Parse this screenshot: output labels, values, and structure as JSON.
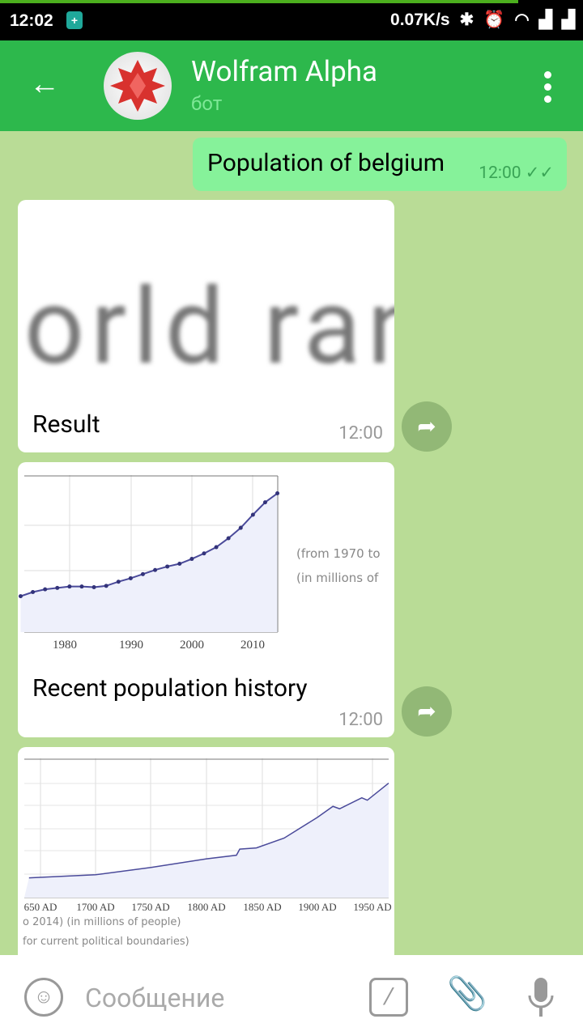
{
  "status_bar": {
    "time": "12:02",
    "net_speed": "0.07K/s",
    "icons": [
      "notification-icon",
      "bluetooth-icon",
      "alarm-icon",
      "wifi-icon",
      "signal-icon",
      "signal-icon"
    ]
  },
  "header": {
    "title": "Wolfram Alpha",
    "subtitle": "бот",
    "accent": "#2db84c"
  },
  "messages": [
    {
      "type": "outgoing",
      "text": "Population of belgium",
      "time": "12:00",
      "status": "read"
    },
    {
      "type": "incoming",
      "image_text": "orld ran",
      "caption": "Result",
      "time": "12:00"
    },
    {
      "type": "incoming",
      "caption": "Recent population history",
      "time": "12:00",
      "image": {
        "note1": "(from 1970 to",
        "note2": "(in millions of",
        "x_ticks": [
          "1980",
          "1990",
          "2000",
          "2010"
        ]
      }
    },
    {
      "type": "incoming",
      "image": {
        "note1": "o 2014)  (in millions of people)",
        "note2": "for current political boundaries)",
        "x_ticks": [
          "650 AD",
          "1700 AD",
          "1750 AD",
          "1800 AD",
          "1850 AD",
          "1900 AD",
          "1950 AD"
        ]
      }
    }
  ],
  "chart_data": [
    {
      "type": "line",
      "xlabel": "",
      "ylabel": "",
      "x": [
        1972,
        1974,
        1976,
        1978,
        1980,
        1982,
        1984,
        1986,
        1988,
        1990,
        1992,
        1994,
        1996,
        1998,
        2000,
        2002,
        2004,
        2006,
        2008,
        2010,
        2012,
        2014
      ],
      "values": [
        9.71,
        9.77,
        9.81,
        9.83,
        9.85,
        9.85,
        9.84,
        9.86,
        9.92,
        9.97,
        10.03,
        10.09,
        10.14,
        10.18,
        10.25,
        10.33,
        10.42,
        10.55,
        10.7,
        10.89,
        11.07,
        11.2
      ]
    },
    {
      "type": "area",
      "xlabel": "",
      "ylabel": "",
      "x": [
        1640,
        1700,
        1750,
        1800,
        1827,
        1830,
        1845,
        1870,
        1900,
        1914,
        1920,
        1940,
        1945,
        1966
      ],
      "values": [
        1.75,
        2.0,
        2.6,
        3.3,
        3.6,
        4.1,
        4.2,
        5.0,
        6.7,
        7.6,
        7.4,
        8.3,
        8.1,
        9.5
      ]
    }
  ],
  "input": {
    "placeholder": "Сообщение"
  }
}
